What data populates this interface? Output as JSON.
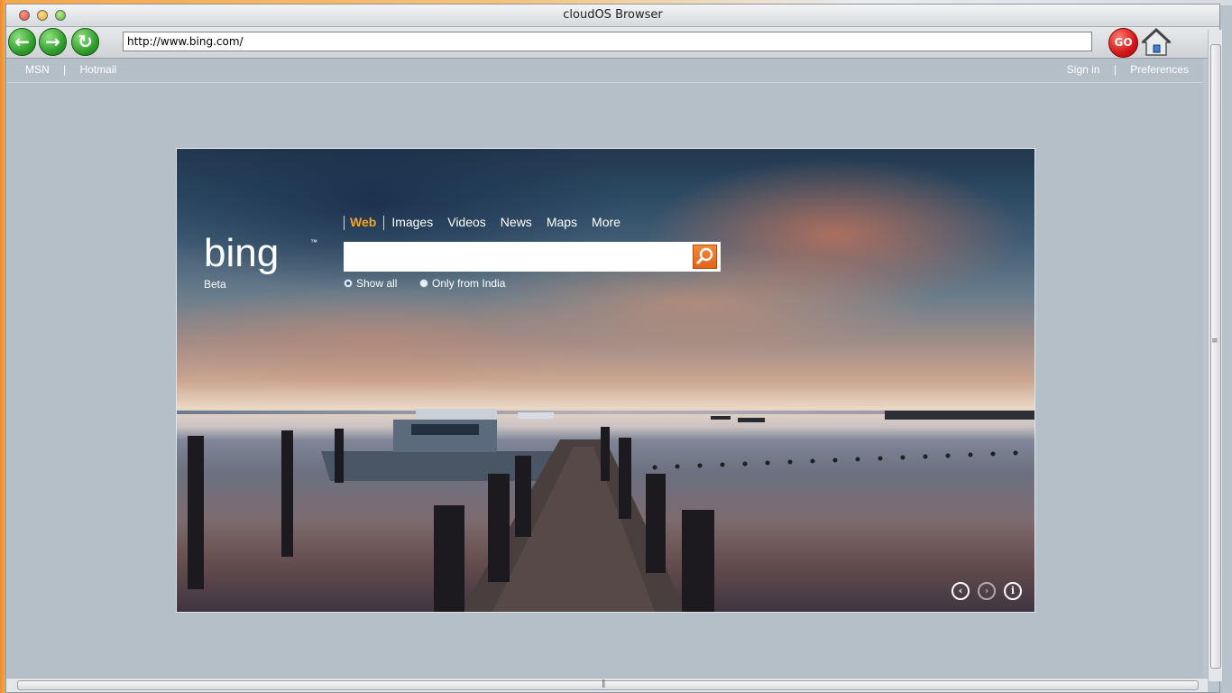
{
  "window": {
    "title": "cloudOS Browser"
  },
  "toolbar": {
    "url": "http://www.bing.com/",
    "go_label": "GO"
  },
  "page": {
    "topnav_left": [
      "MSN",
      "Hotmail"
    ],
    "topnav_right": [
      "Sign in",
      "Preferences"
    ],
    "separator": "|",
    "logo_beta": "Beta",
    "tabs": [
      "Web",
      "Images",
      "Videos",
      "News",
      "Maps",
      "More"
    ],
    "active_tab": "Web",
    "search_value": "",
    "radios": [
      {
        "label": "Show all",
        "selected": true
      },
      {
        "label": "Only from India",
        "selected": false
      }
    ],
    "accent_color": "#f7a823"
  }
}
